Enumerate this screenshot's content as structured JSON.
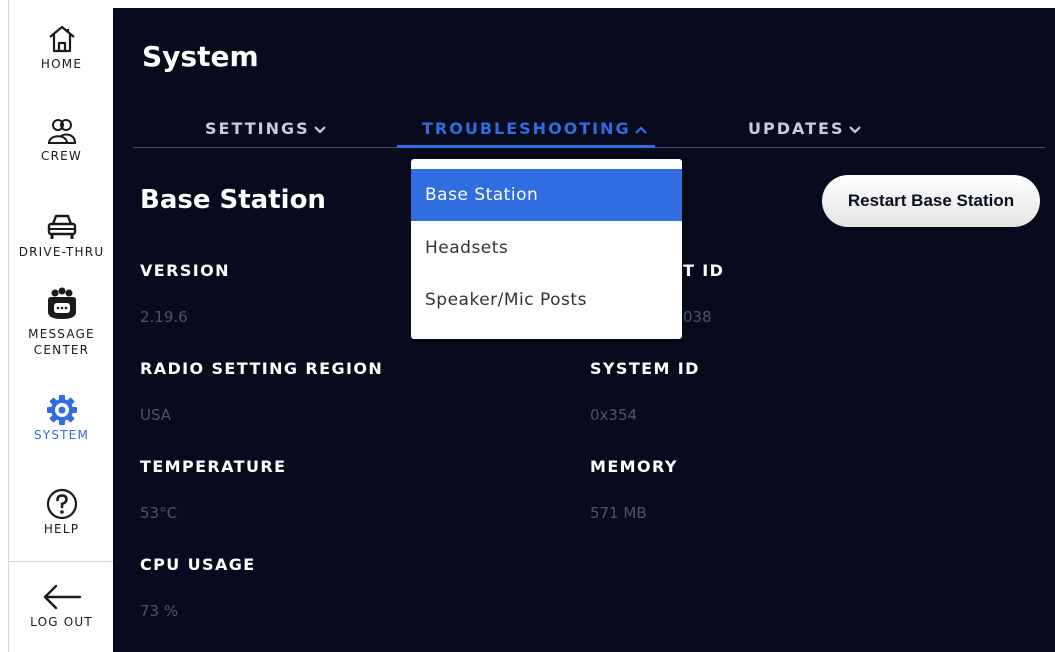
{
  "sidebar": {
    "items": [
      {
        "label": "HOME",
        "icon": "home-icon"
      },
      {
        "label": "CREW",
        "icon": "crew-icon"
      },
      {
        "label": "DRIVE-THRU",
        "icon": "car-icon"
      },
      {
        "label": "MESSAGE\nCENTER",
        "label_line1": "MESSAGE",
        "label_line2": "CENTER",
        "icon": "message-center-icon"
      },
      {
        "label": "SYSTEM",
        "icon": "gear-icon",
        "active": true
      },
      {
        "label": "HELP",
        "icon": "help-icon"
      },
      {
        "label": "LOG OUT",
        "icon": "arrow-left-icon"
      }
    ]
  },
  "header": {
    "title": "System"
  },
  "tabs": [
    {
      "label": "SETTINGS",
      "expanded": false
    },
    {
      "label": "TROUBLESHOOTING",
      "expanded": true,
      "active": true
    },
    {
      "label": "UPDATES",
      "expanded": false
    }
  ],
  "section": {
    "title": "Base Station",
    "restart_label": "Restart Base Station"
  },
  "fields": {
    "version": {
      "label": "VERSION",
      "value": "2.19.6"
    },
    "serial": {
      "label": "T ID",
      "value": "038"
    },
    "radio_region": {
      "label": "RADIO SETTING REGION",
      "value": "USA"
    },
    "system_id": {
      "label": "SYSTEM ID",
      "value": "0x354"
    },
    "temperature": {
      "label": "TEMPERATURE",
      "value": "53°C"
    },
    "memory": {
      "label": "MEMORY",
      "value": "571 MB"
    },
    "cpu": {
      "label": "CPU USAGE",
      "value": "73 %"
    }
  },
  "dropdown": {
    "items": [
      {
        "label": "Base Station",
        "selected": true
      },
      {
        "label": "Headsets"
      },
      {
        "label": "Speaker/Mic Posts"
      }
    ]
  },
  "colors": {
    "accent": "#2f6de1",
    "background": "#070b1d",
    "muted_value": "#4d546a"
  }
}
